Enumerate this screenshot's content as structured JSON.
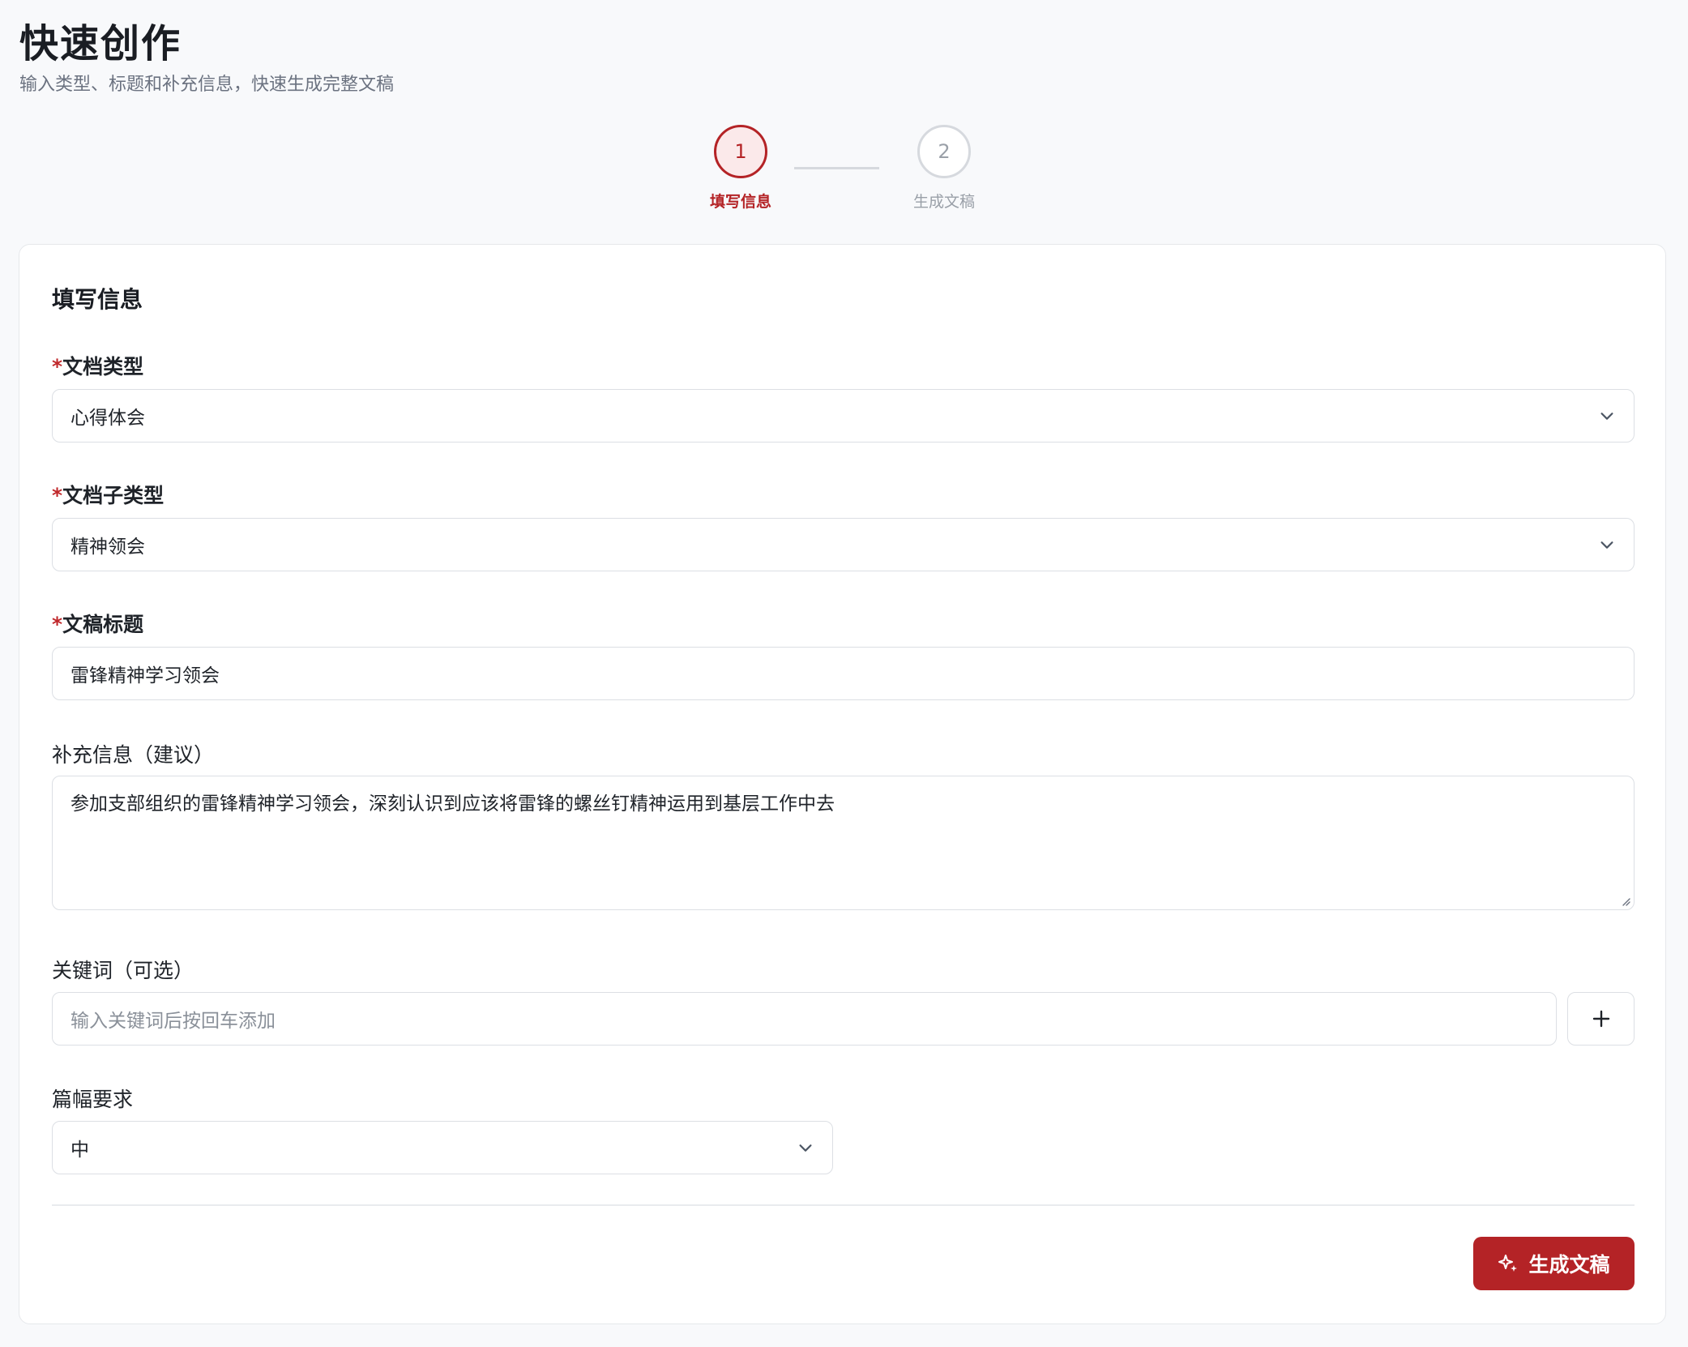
{
  "header": {
    "title": "快速创作",
    "subtitle": "输入类型、标题和补充信息，快速生成完整文稿"
  },
  "stepper": {
    "steps": [
      {
        "number": "1",
        "label": "填写信息",
        "state": "active"
      },
      {
        "number": "2",
        "label": "生成文稿",
        "state": "inactive"
      }
    ]
  },
  "form": {
    "card_title": "填写信息",
    "required_mark": "*",
    "doc_type": {
      "label": "文档类型",
      "value": "心得体会"
    },
    "doc_subtype": {
      "label": "文档子类型",
      "value": "精神领会"
    },
    "doc_title": {
      "label": "文稿标题",
      "value": "雷锋精神学习领会"
    },
    "supplement": {
      "label": "补充信息（建议）",
      "value": "参加支部组织的雷锋精神学习领会，深刻认识到应该将雷锋的螺丝钉精神运用到基层工作中去"
    },
    "keywords": {
      "label": "关键词（可选）",
      "placeholder": "输入关键词后按回车添加",
      "add_icon": "plus-icon"
    },
    "length": {
      "label": "篇幅要求",
      "value": "中"
    },
    "generate_button": {
      "label": "生成文稿",
      "icon": "sparkle-icon"
    }
  },
  "colors": {
    "accent": "#b42326",
    "accent_light": "#fbe9ea",
    "border": "#dcdfe4",
    "muted_text": "#6b7280"
  }
}
